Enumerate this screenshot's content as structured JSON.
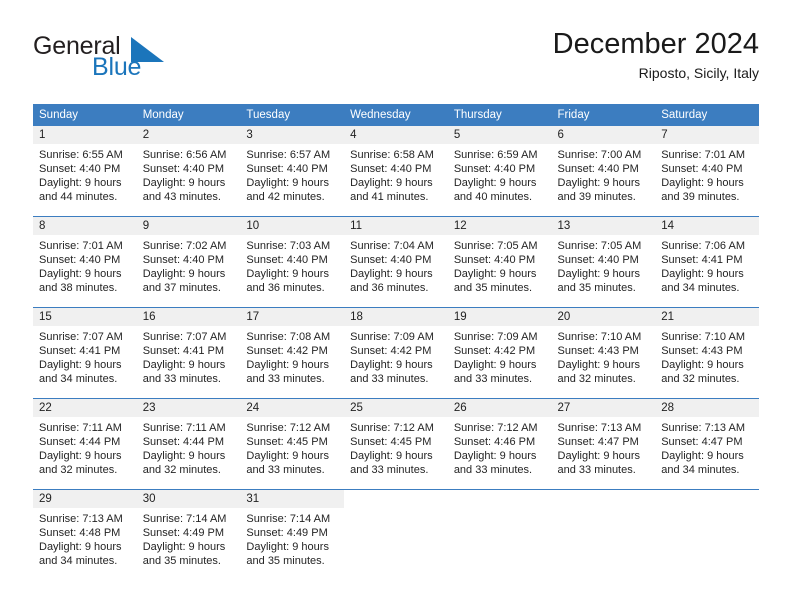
{
  "brand": {
    "name_part1": "General",
    "name_part2": "Blue",
    "triangle_color": "#1b75bb"
  },
  "header": {
    "title": "December 2024",
    "subtitle": "Riposto, Sicily, Italy"
  },
  "theme": {
    "header_row_bg": "#3c7dc0",
    "daynum_bg": "#f0f0f0",
    "accent": "#1b75bb",
    "text": "#242424"
  },
  "weekdays": [
    "Sunday",
    "Monday",
    "Tuesday",
    "Wednesday",
    "Thursday",
    "Friday",
    "Saturday"
  ],
  "weeks": [
    [
      {
        "day": "1",
        "sunrise": "Sunrise: 6:55 AM",
        "sunset": "Sunset: 4:40 PM",
        "daylight1": "Daylight: 9 hours",
        "daylight2": "and 44 minutes."
      },
      {
        "day": "2",
        "sunrise": "Sunrise: 6:56 AM",
        "sunset": "Sunset: 4:40 PM",
        "daylight1": "Daylight: 9 hours",
        "daylight2": "and 43 minutes."
      },
      {
        "day": "3",
        "sunrise": "Sunrise: 6:57 AM",
        "sunset": "Sunset: 4:40 PM",
        "daylight1": "Daylight: 9 hours",
        "daylight2": "and 42 minutes."
      },
      {
        "day": "4",
        "sunrise": "Sunrise: 6:58 AM",
        "sunset": "Sunset: 4:40 PM",
        "daylight1": "Daylight: 9 hours",
        "daylight2": "and 41 minutes."
      },
      {
        "day": "5",
        "sunrise": "Sunrise: 6:59 AM",
        "sunset": "Sunset: 4:40 PM",
        "daylight1": "Daylight: 9 hours",
        "daylight2": "and 40 minutes."
      },
      {
        "day": "6",
        "sunrise": "Sunrise: 7:00 AM",
        "sunset": "Sunset: 4:40 PM",
        "daylight1": "Daylight: 9 hours",
        "daylight2": "and 39 minutes."
      },
      {
        "day": "7",
        "sunrise": "Sunrise: 7:01 AM",
        "sunset": "Sunset: 4:40 PM",
        "daylight1": "Daylight: 9 hours",
        "daylight2": "and 39 minutes."
      }
    ],
    [
      {
        "day": "8",
        "sunrise": "Sunrise: 7:01 AM",
        "sunset": "Sunset: 4:40 PM",
        "daylight1": "Daylight: 9 hours",
        "daylight2": "and 38 minutes."
      },
      {
        "day": "9",
        "sunrise": "Sunrise: 7:02 AM",
        "sunset": "Sunset: 4:40 PM",
        "daylight1": "Daylight: 9 hours",
        "daylight2": "and 37 minutes."
      },
      {
        "day": "10",
        "sunrise": "Sunrise: 7:03 AM",
        "sunset": "Sunset: 4:40 PM",
        "daylight1": "Daylight: 9 hours",
        "daylight2": "and 36 minutes."
      },
      {
        "day": "11",
        "sunrise": "Sunrise: 7:04 AM",
        "sunset": "Sunset: 4:40 PM",
        "daylight1": "Daylight: 9 hours",
        "daylight2": "and 36 minutes."
      },
      {
        "day": "12",
        "sunrise": "Sunrise: 7:05 AM",
        "sunset": "Sunset: 4:40 PM",
        "daylight1": "Daylight: 9 hours",
        "daylight2": "and 35 minutes."
      },
      {
        "day": "13",
        "sunrise": "Sunrise: 7:05 AM",
        "sunset": "Sunset: 4:40 PM",
        "daylight1": "Daylight: 9 hours",
        "daylight2": "and 35 minutes."
      },
      {
        "day": "14",
        "sunrise": "Sunrise: 7:06 AM",
        "sunset": "Sunset: 4:41 PM",
        "daylight1": "Daylight: 9 hours",
        "daylight2": "and 34 minutes."
      }
    ],
    [
      {
        "day": "15",
        "sunrise": "Sunrise: 7:07 AM",
        "sunset": "Sunset: 4:41 PM",
        "daylight1": "Daylight: 9 hours",
        "daylight2": "and 34 minutes."
      },
      {
        "day": "16",
        "sunrise": "Sunrise: 7:07 AM",
        "sunset": "Sunset: 4:41 PM",
        "daylight1": "Daylight: 9 hours",
        "daylight2": "and 33 minutes."
      },
      {
        "day": "17",
        "sunrise": "Sunrise: 7:08 AM",
        "sunset": "Sunset: 4:42 PM",
        "daylight1": "Daylight: 9 hours",
        "daylight2": "and 33 minutes."
      },
      {
        "day": "18",
        "sunrise": "Sunrise: 7:09 AM",
        "sunset": "Sunset: 4:42 PM",
        "daylight1": "Daylight: 9 hours",
        "daylight2": "and 33 minutes."
      },
      {
        "day": "19",
        "sunrise": "Sunrise: 7:09 AM",
        "sunset": "Sunset: 4:42 PM",
        "daylight1": "Daylight: 9 hours",
        "daylight2": "and 33 minutes."
      },
      {
        "day": "20",
        "sunrise": "Sunrise: 7:10 AM",
        "sunset": "Sunset: 4:43 PM",
        "daylight1": "Daylight: 9 hours",
        "daylight2": "and 32 minutes."
      },
      {
        "day": "21",
        "sunrise": "Sunrise: 7:10 AM",
        "sunset": "Sunset: 4:43 PM",
        "daylight1": "Daylight: 9 hours",
        "daylight2": "and 32 minutes."
      }
    ],
    [
      {
        "day": "22",
        "sunrise": "Sunrise: 7:11 AM",
        "sunset": "Sunset: 4:44 PM",
        "daylight1": "Daylight: 9 hours",
        "daylight2": "and 32 minutes."
      },
      {
        "day": "23",
        "sunrise": "Sunrise: 7:11 AM",
        "sunset": "Sunset: 4:44 PM",
        "daylight1": "Daylight: 9 hours",
        "daylight2": "and 32 minutes."
      },
      {
        "day": "24",
        "sunrise": "Sunrise: 7:12 AM",
        "sunset": "Sunset: 4:45 PM",
        "daylight1": "Daylight: 9 hours",
        "daylight2": "and 33 minutes."
      },
      {
        "day": "25",
        "sunrise": "Sunrise: 7:12 AM",
        "sunset": "Sunset: 4:45 PM",
        "daylight1": "Daylight: 9 hours",
        "daylight2": "and 33 minutes."
      },
      {
        "day": "26",
        "sunrise": "Sunrise: 7:12 AM",
        "sunset": "Sunset: 4:46 PM",
        "daylight1": "Daylight: 9 hours",
        "daylight2": "and 33 minutes."
      },
      {
        "day": "27",
        "sunrise": "Sunrise: 7:13 AM",
        "sunset": "Sunset: 4:47 PM",
        "daylight1": "Daylight: 9 hours",
        "daylight2": "and 33 minutes."
      },
      {
        "day": "28",
        "sunrise": "Sunrise: 7:13 AM",
        "sunset": "Sunset: 4:47 PM",
        "daylight1": "Daylight: 9 hours",
        "daylight2": "and 34 minutes."
      }
    ],
    [
      {
        "day": "29",
        "sunrise": "Sunrise: 7:13 AM",
        "sunset": "Sunset: 4:48 PM",
        "daylight1": "Daylight: 9 hours",
        "daylight2": "and 34 minutes."
      },
      {
        "day": "30",
        "sunrise": "Sunrise: 7:14 AM",
        "sunset": "Sunset: 4:49 PM",
        "daylight1": "Daylight: 9 hours",
        "daylight2": "and 35 minutes."
      },
      {
        "day": "31",
        "sunrise": "Sunrise: 7:14 AM",
        "sunset": "Sunset: 4:49 PM",
        "daylight1": "Daylight: 9 hours",
        "daylight2": "and 35 minutes."
      },
      {
        "day": "",
        "sunrise": "",
        "sunset": "",
        "daylight1": "",
        "daylight2": ""
      },
      {
        "day": "",
        "sunrise": "",
        "sunset": "",
        "daylight1": "",
        "daylight2": ""
      },
      {
        "day": "",
        "sunrise": "",
        "sunset": "",
        "daylight1": "",
        "daylight2": ""
      },
      {
        "day": "",
        "sunrise": "",
        "sunset": "",
        "daylight1": "",
        "daylight2": ""
      }
    ]
  ]
}
